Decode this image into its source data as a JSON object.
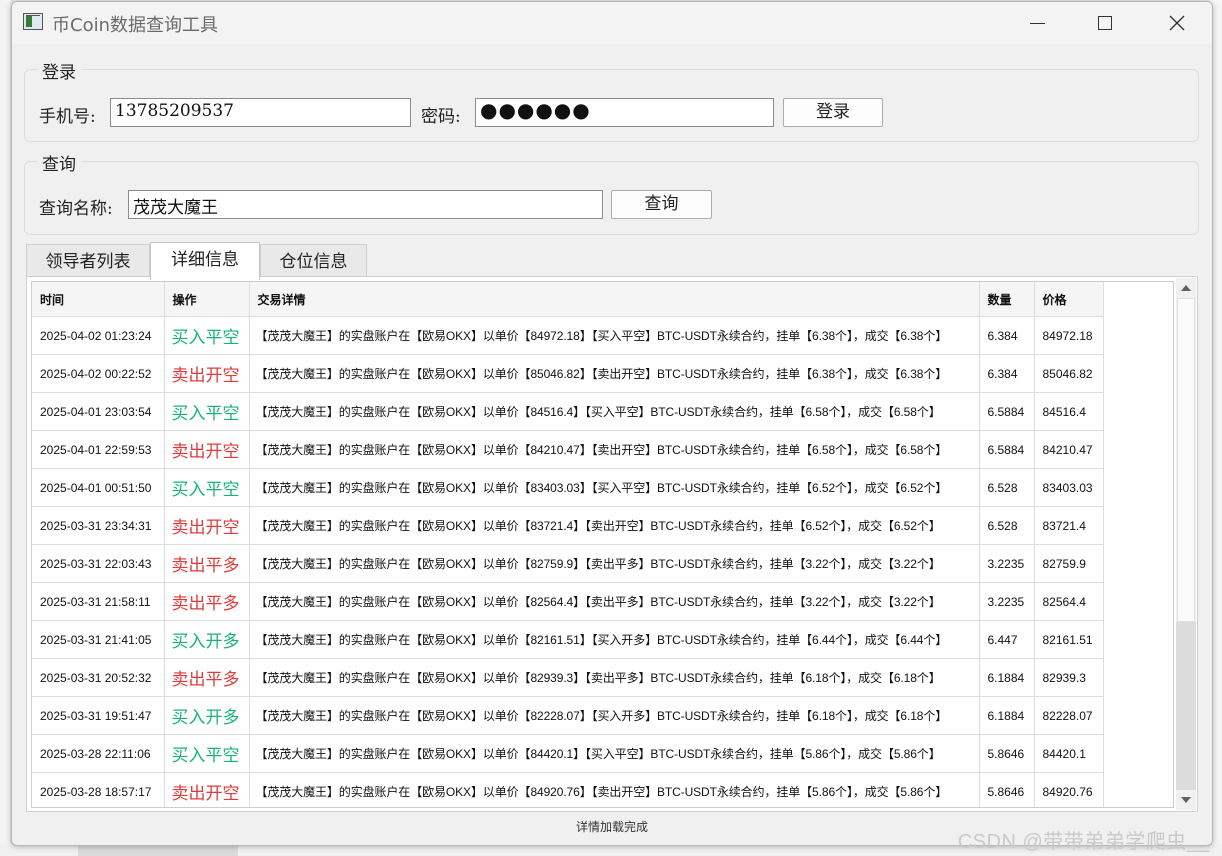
{
  "window": {
    "title": "币Coin数据查询工具"
  },
  "login": {
    "group_title": "登录",
    "phone_label": "手机号:",
    "phone_value": "13785209537",
    "password_label": "密码:",
    "password_mask": "●●●●●●",
    "login_button": "登录"
  },
  "query": {
    "group_title": "查询",
    "name_label": "查询名称:",
    "name_value": "茂茂大魔王",
    "query_button": "查询"
  },
  "tabs": [
    {
      "label": "领导者列表",
      "active": false
    },
    {
      "label": "详细信息",
      "active": true
    },
    {
      "label": "仓位信息",
      "active": false
    }
  ],
  "table": {
    "columns": [
      "时间",
      "操作",
      "交易详情",
      "数量",
      "价格"
    ],
    "rows": [
      {
        "time": "2025-04-02 01:23:24",
        "op": "买入平空",
        "op_type": "buy",
        "detail": "【茂茂大魔王】的实盘账户在【欧易OKX】以单价【84972.18】【买入平空】BTC-USDT永续合约，挂单【6.38个】，成交【6.38个】",
        "qty": "6.384",
        "price": "84972.18"
      },
      {
        "time": "2025-04-02 00:22:52",
        "op": "卖出开空",
        "op_type": "sell",
        "detail": "【茂茂大魔王】的实盘账户在【欧易OKX】以单价【85046.82】【卖出开空】BTC-USDT永续合约，挂单【6.38个】，成交【6.38个】",
        "qty": "6.384",
        "price": "85046.82"
      },
      {
        "time": "2025-04-01 23:03:54",
        "op": "买入平空",
        "op_type": "buy",
        "detail": "【茂茂大魔王】的实盘账户在【欧易OKX】以单价【84516.4】【买入平空】BTC-USDT永续合约，挂单【6.58个】，成交【6.58个】",
        "qty": "6.5884",
        "price": "84516.4"
      },
      {
        "time": "2025-04-01 22:59:53",
        "op": "卖出开空",
        "op_type": "sell",
        "detail": "【茂茂大魔王】的实盘账户在【欧易OKX】以单价【84210.47】【卖出开空】BTC-USDT永续合约，挂单【6.58个】，成交【6.58个】",
        "qty": "6.5884",
        "price": "84210.47"
      },
      {
        "time": "2025-04-01 00:51:50",
        "op": "买入平空",
        "op_type": "buy",
        "detail": "【茂茂大魔王】的实盘账户在【欧易OKX】以单价【83403.03】【买入平空】BTC-USDT永续合约，挂单【6.52个】，成交【6.52个】",
        "qty": "6.528",
        "price": "83403.03"
      },
      {
        "time": "2025-03-31 23:34:31",
        "op": "卖出开空",
        "op_type": "sell",
        "detail": "【茂茂大魔王】的实盘账户在【欧易OKX】以单价【83721.4】【卖出开空】BTC-USDT永续合约，挂单【6.52个】，成交【6.52个】",
        "qty": "6.528",
        "price": "83721.4"
      },
      {
        "time": "2025-03-31 22:03:43",
        "op": "卖出平多",
        "op_type": "sell",
        "detail": "【茂茂大魔王】的实盘账户在【欧易OKX】以单价【82759.9】【卖出平多】BTC-USDT永续合约，挂单【3.22个】，成交【3.22个】",
        "qty": "3.2235",
        "price": "82759.9"
      },
      {
        "time": "2025-03-31 21:58:11",
        "op": "卖出平多",
        "op_type": "sell",
        "detail": "【茂茂大魔王】的实盘账户在【欧易OKX】以单价【82564.4】【卖出平多】BTC-USDT永续合约，挂单【3.22个】，成交【3.22个】",
        "qty": "3.2235",
        "price": "82564.4"
      },
      {
        "time": "2025-03-31 21:41:05",
        "op": "买入开多",
        "op_type": "buy",
        "detail": "【茂茂大魔王】的实盘账户在【欧易OKX】以单价【82161.51】【买入开多】BTC-USDT永续合约，挂单【6.44个】，成交【6.44个】",
        "qty": "6.447",
        "price": "82161.51"
      },
      {
        "time": "2025-03-31 20:52:32",
        "op": "卖出平多",
        "op_type": "sell",
        "detail": "【茂茂大魔王】的实盘账户在【欧易OKX】以单价【82939.3】【卖出平多】BTC-USDT永续合约，挂单【6.18个】，成交【6.18个】",
        "qty": "6.1884",
        "price": "82939.3"
      },
      {
        "time": "2025-03-31 19:51:47",
        "op": "买入开多",
        "op_type": "buy",
        "detail": "【茂茂大魔王】的实盘账户在【欧易OKX】以单价【82228.07】【买入开多】BTC-USDT永续合约，挂单【6.18个】，成交【6.18个】",
        "qty": "6.1884",
        "price": "82228.07"
      },
      {
        "time": "2025-03-28 22:11:06",
        "op": "买入平空",
        "op_type": "buy",
        "detail": "【茂茂大魔王】的实盘账户在【欧易OKX】以单价【84420.1】【买入平空】BTC-USDT永续合约，挂单【5.86个】，成交【5.86个】",
        "qty": "5.8646",
        "price": "84420.1"
      },
      {
        "time": "2025-03-28 18:57:17",
        "op": "卖出开空",
        "op_type": "sell",
        "detail": "【茂茂大魔王】的实盘账户在【欧易OKX】以单价【84920.76】【卖出开空】BTC-USDT永续合约，挂单【5.86个】，成交【5.86个】",
        "qty": "5.8646",
        "price": "84920.76"
      }
    ]
  },
  "status": {
    "text": "详情加载完成"
  },
  "watermark": {
    "text": "CSDN @带带弟弟学爬虫__"
  },
  "colors": {
    "buy": "#19b37a",
    "sell": "#e03a3a"
  },
  "icons": {
    "minimize": "minimize-icon",
    "maximize": "maximize-icon",
    "close": "close-icon"
  }
}
